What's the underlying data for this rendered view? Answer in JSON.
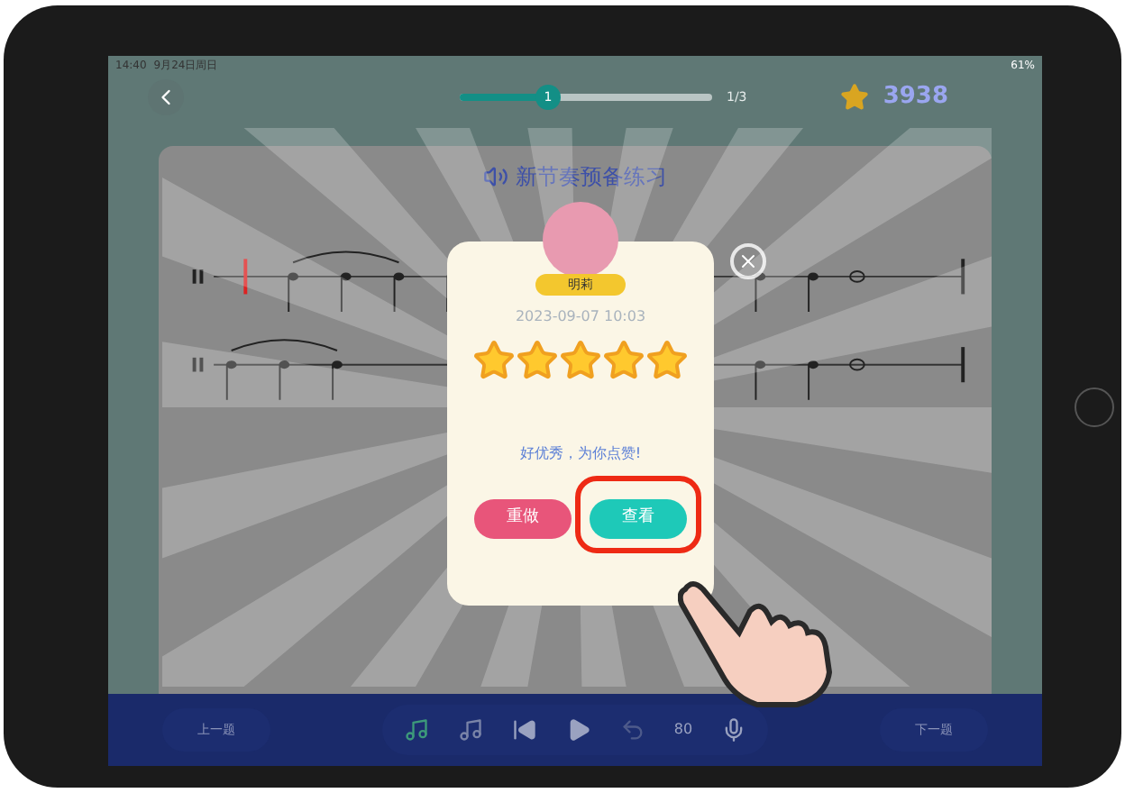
{
  "status_bar": {
    "time": "14:40",
    "date": "9月24日周日",
    "battery": "61%"
  },
  "progress": {
    "step": "1",
    "level": 0.35,
    "count": "1/3"
  },
  "score": "3938",
  "exercise": {
    "title": "新节奏预备练习"
  },
  "result": {
    "name": "明莉",
    "time": "2023-09-07 10:03",
    "stars": 5,
    "message": "好优秀，为你点赞!",
    "buttons": [
      {
        "label": "重做",
        "kind": "redo",
        "highlighted": false
      },
      {
        "label": "查看",
        "kind": "view",
        "highlighted": true
      }
    ]
  },
  "toolbar": {
    "prev": "上一题",
    "next": "下一题",
    "tempo": "80"
  }
}
